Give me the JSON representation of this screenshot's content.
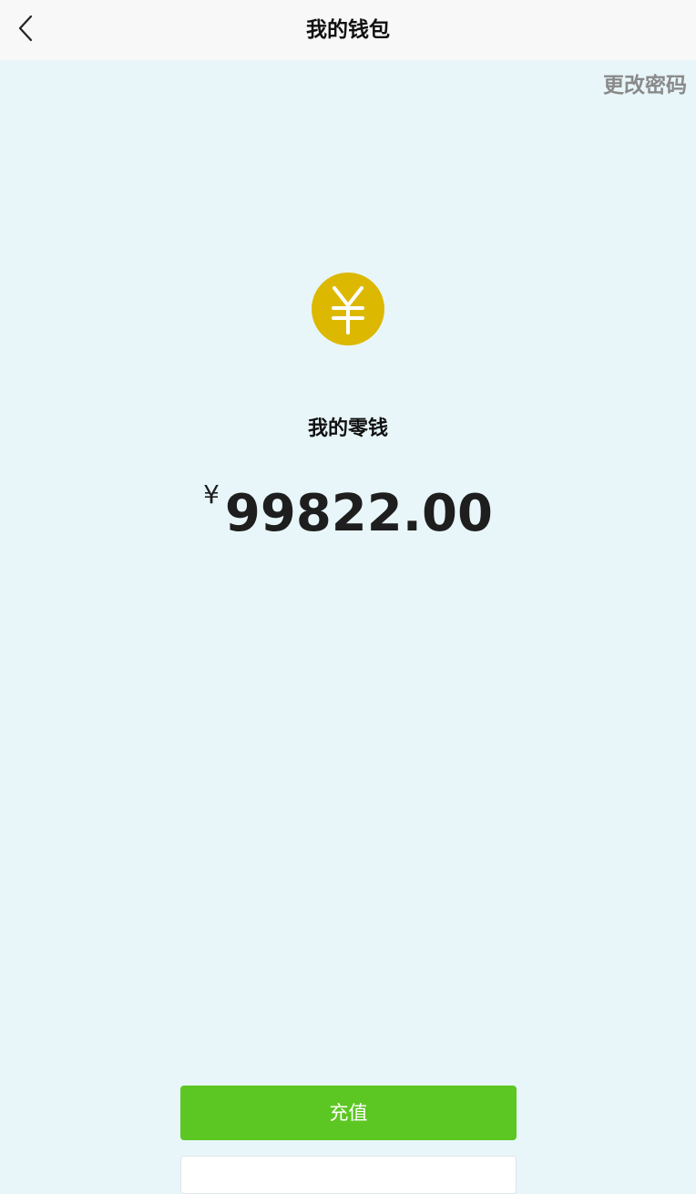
{
  "header": {
    "back_icon": "chevron-left-icon",
    "title": "我的钱包",
    "change_password_label": "更改密码"
  },
  "wallet": {
    "coin_icon": "yuan-coin-icon",
    "coin_color": "#dcb800",
    "section_title": "我的零钱",
    "currency_symbol": "¥",
    "balance": "99822.00"
  },
  "actions": {
    "recharge_label": "充值",
    "recharge_color": "#5cc722"
  },
  "colors": {
    "background": "#e8f6fa",
    "navbar": "#f8f8f8",
    "muted_text": "#8a8a8a"
  }
}
